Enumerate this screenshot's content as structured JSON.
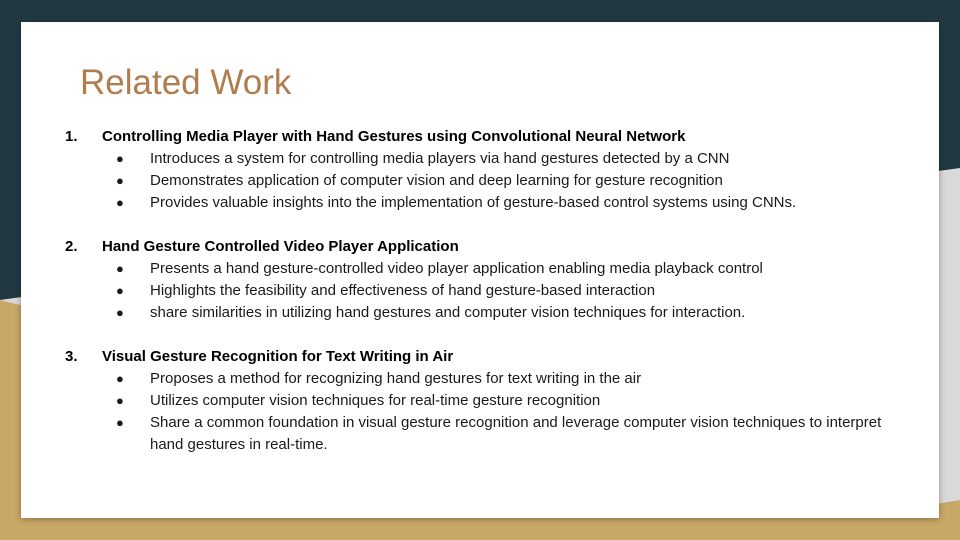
{
  "colors": {
    "title": "#b07d4f",
    "dark_bg": "#213843",
    "gold_bg": "#c9a867",
    "light_bg": "#d9d9d9",
    "card": "#ffffff"
  },
  "slide": {
    "title": "Related Work",
    "bullet_glyph": "●",
    "sections": [
      {
        "number": "1.",
        "title": "Controlling Media Player with Hand Gestures using Convolutional Neural Network",
        "bullets": [
          "Introduces a system for controlling media players via hand gestures detected by a CNN",
          "Demonstrates application of computer vision and deep learning for gesture recognition",
          "Provides valuable insights into the implementation of gesture-based control systems using CNNs."
        ]
      },
      {
        "number": "2.",
        "title": "Hand Gesture Controlled Video Player Application",
        "bullets": [
          "Presents a hand gesture-controlled video player application enabling media playback control",
          "Highlights the feasibility and effectiveness of hand gesture-based interaction",
          "share similarities in utilizing hand gestures and computer vision techniques for interaction."
        ]
      },
      {
        "number": "3.",
        "title": "Visual Gesture Recognition for Text Writing in Air",
        "bullets": [
          "Proposes a method for recognizing hand gestures for text writing in the air",
          "Utilizes computer vision techniques for real-time gesture recognition",
          "Share a common foundation in visual gesture recognition and leverage computer vision techniques to interpret hand gestures in real-time."
        ]
      }
    ]
  }
}
